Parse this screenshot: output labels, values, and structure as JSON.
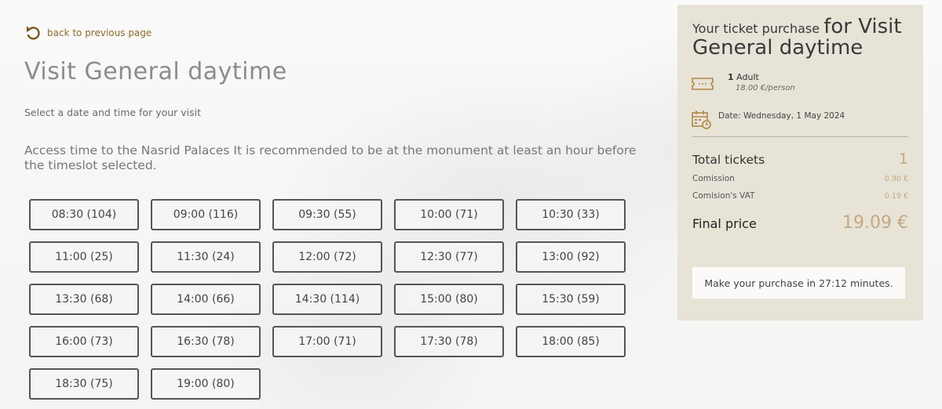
{
  "nav": {
    "back_label": "back to previous page"
  },
  "page": {
    "title": "Visit General daytime",
    "subtitle": "Select a date and time for your visit",
    "access_note": "Access time to the Nasrid Palaces It is recommended to be at the monument at least an hour before the timeslot selected."
  },
  "timeslots": [
    "08:30 (104)",
    "09:00 (116)",
    "09:30 (55)",
    "10:00 (71)",
    "10:30 (33)",
    "11:00 (25)",
    "11:30 (24)",
    "12:00 (72)",
    "12:30 (77)",
    "13:00 (92)",
    "13:30 (68)",
    "14:00 (66)",
    "14:30 (114)",
    "15:00 (80)",
    "15:30 (59)",
    "16:00 (73)",
    "16:30 (78)",
    "17:00 (71)",
    "17:30 (78)",
    "18:00 (85)",
    "18:30 (75)",
    "19:00 (80)"
  ],
  "summary": {
    "heading_small": "Your ticket purchase ",
    "heading_big_a": "for Visit",
    "heading_big_b": "General daytime",
    "ticket_qty": "1",
    "ticket_type": "Adult",
    "ticket_price": "18.00 €/person",
    "date_label": "Date: Wednesday, 1 May 2024",
    "total_tickets_label": "Total tickets",
    "total_tickets_value": "1",
    "commission_label": "Comission",
    "commission_value": "0.90 €",
    "vat_label": "Comision's VAT",
    "vat_value": "0.19 €",
    "final_label": "Final price",
    "final_value": "19.09 €",
    "timer_text": "Make your purchase in 27:12 minutes."
  },
  "colors": {
    "accent": "#c4a882",
    "link": "#8a6a2e",
    "panel": "#e8e3d7"
  }
}
